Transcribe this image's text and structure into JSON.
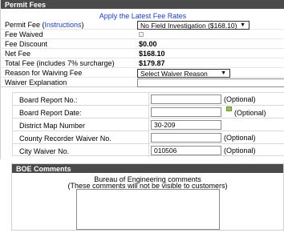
{
  "permit_fees": {
    "header": "Permit Fees",
    "apply_link": "Apply the Latest Fee Rates",
    "rows": {
      "permit_fee": {
        "label": "Permit Fee",
        "instructions": "Instructions",
        "select_value": "No Field Investigation ($168.10)"
      },
      "fee_waived": {
        "label": "Fee Waived"
      },
      "fee_discount": {
        "label": "Fee Discount",
        "value": "$0.00"
      },
      "net_fee": {
        "label": "Net Fee",
        "value": "$168.10"
      },
      "total_fee": {
        "label": "Total Fee (includes 7% surcharge)",
        "value": "$179.87"
      },
      "waiver_reason": {
        "label": "Reason for Waiving Fee",
        "select_value": "Select Waiver Reason"
      },
      "waiver_explanation": {
        "label": "Waiver Explanation",
        "value": ""
      }
    },
    "board": {
      "report_no": {
        "label": "Board Report No.:",
        "value": "",
        "optional": "(Optional)"
      },
      "report_date": {
        "label": "Board Report Date:",
        "value": "",
        "optional": "(Optional)"
      },
      "district_map": {
        "label": "District Map Number",
        "value": "30-209"
      },
      "county_waiver": {
        "label": "County Recorder Waiver No.",
        "value": "",
        "optional": "(Optional)"
      },
      "city_waiver": {
        "label": "City Waiver No.",
        "value": "010506",
        "optional": "(Optional)"
      }
    }
  },
  "boe_comments": {
    "header": "BOE Comments",
    "line1": "Bureau of Engineering comments",
    "line2": "(These comments will not be visible to customers)",
    "text": ""
  }
}
